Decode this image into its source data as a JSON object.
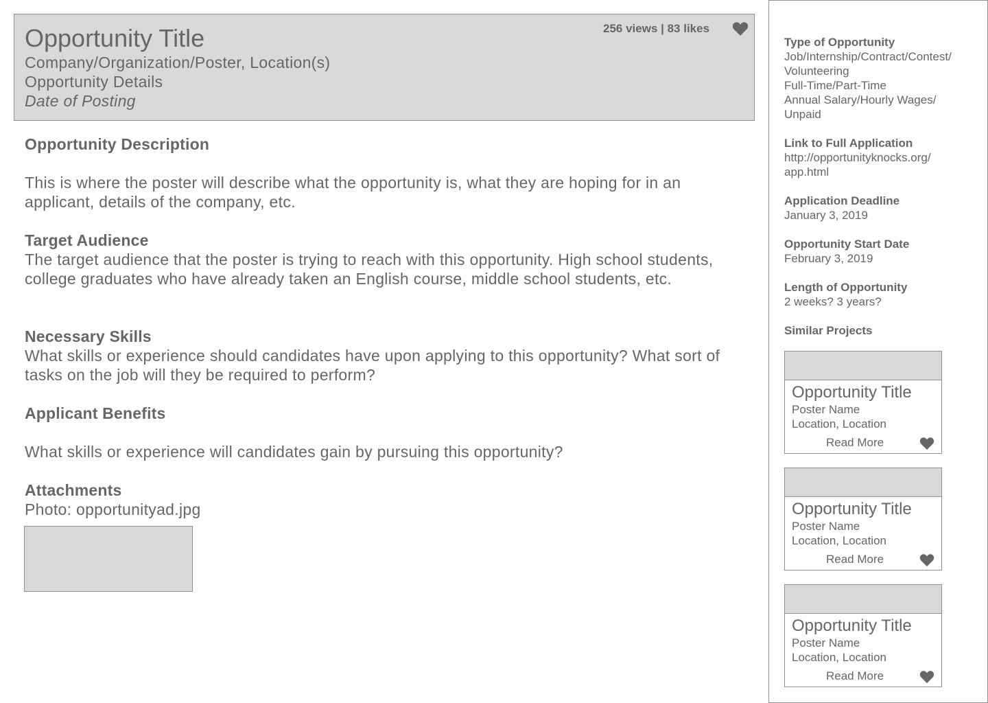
{
  "header": {
    "title": "Opportunity Title",
    "company": "Company/Organization/Poster, Location(s)",
    "details": "Opportunity Details",
    "date": "Date of Posting",
    "stats": "256 views | 83 likes",
    "heart_icon": "heart-icon"
  },
  "main": {
    "description_title": "Opportunity Description",
    "description_text": "This is where the poster will describe what the opportunity is, what they are hoping for in an applicant, details of the company, etc.",
    "audience_title": "Target Audience",
    "audience_text": "The target audience that the poster is trying to reach with this opportunity. High school students, college graduates who have already taken an English course, middle school students, etc.",
    "skills_title": "Necessary Skills",
    "skills_text": "What skills or experience should candidates have upon applying to this opportunity? What sort of tasks on the job will they be required to perform?",
    "benefits_title": "Applicant Benefits",
    "benefits_text": "What skills or experience will candidates gain by pursuing this opportunity?",
    "attachments_title": "Attachments",
    "attachments_text": "Photo: opportunityad.jpg"
  },
  "sidebar": {
    "type_label": "Type of Opportunity",
    "type_value_1": "Job/Internship/Contract/Contest/",
    "type_value_2": "Volunteering",
    "type_value_3": "Full-Time/Part-Time",
    "type_value_4": "Annual Salary/Hourly Wages/",
    "type_value_5": "Unpaid",
    "link_label": "Link to Full Application",
    "link_value_1": "http://opportunityknocks.org/",
    "link_value_2": "app.html",
    "deadline_label": "Application Deadline",
    "deadline_value": "January 3, 2019",
    "start_label": "Opportunity Start Date",
    "start_value": "February 3, 2019",
    "length_label": "Length of Opportunity",
    "length_value": "2 weeks? 3 years?",
    "similar_label": "Similar Projects",
    "similar": [
      {
        "title": "Opportunity Title",
        "poster": "Poster Name",
        "location": "Location, Location",
        "read_more": "Read More"
      },
      {
        "title": "Opportunity Title",
        "poster": "Poster Name",
        "location": "Location, Location",
        "read_more": "Read More"
      },
      {
        "title": "Opportunity Title",
        "poster": "Poster Name",
        "location": "Location, Location",
        "read_more": "Read More"
      }
    ]
  },
  "colors": {
    "placeholder_fill": "#d9d9d9",
    "border": "#8f8f8f",
    "text": "#666666"
  }
}
